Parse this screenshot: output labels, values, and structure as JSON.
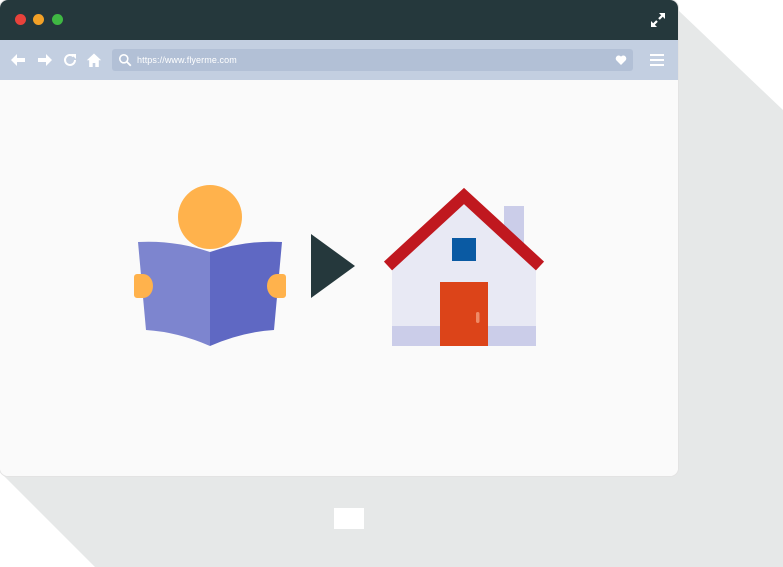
{
  "browser": {
    "url": "https://www.flyerme.com",
    "titlebar_color": "#25383c",
    "navbar_color": "#c3cfe1",
    "traffic_lights": [
      "#e8423b",
      "#f3a127",
      "#3fb843"
    ]
  },
  "illustration": {
    "items": [
      "reader-icon",
      "play-arrow-icon",
      "house-icon"
    ],
    "colors": {
      "head": "#ffb24c",
      "book_left": "#7d85cf",
      "book_right": "#5f68c3",
      "arrow": "#25383c",
      "roof": "#c0181f",
      "wall": "#e8e9f4",
      "window": "#0a5aa3",
      "door": "#dc4419",
      "chimney": "#cbcde9"
    }
  }
}
